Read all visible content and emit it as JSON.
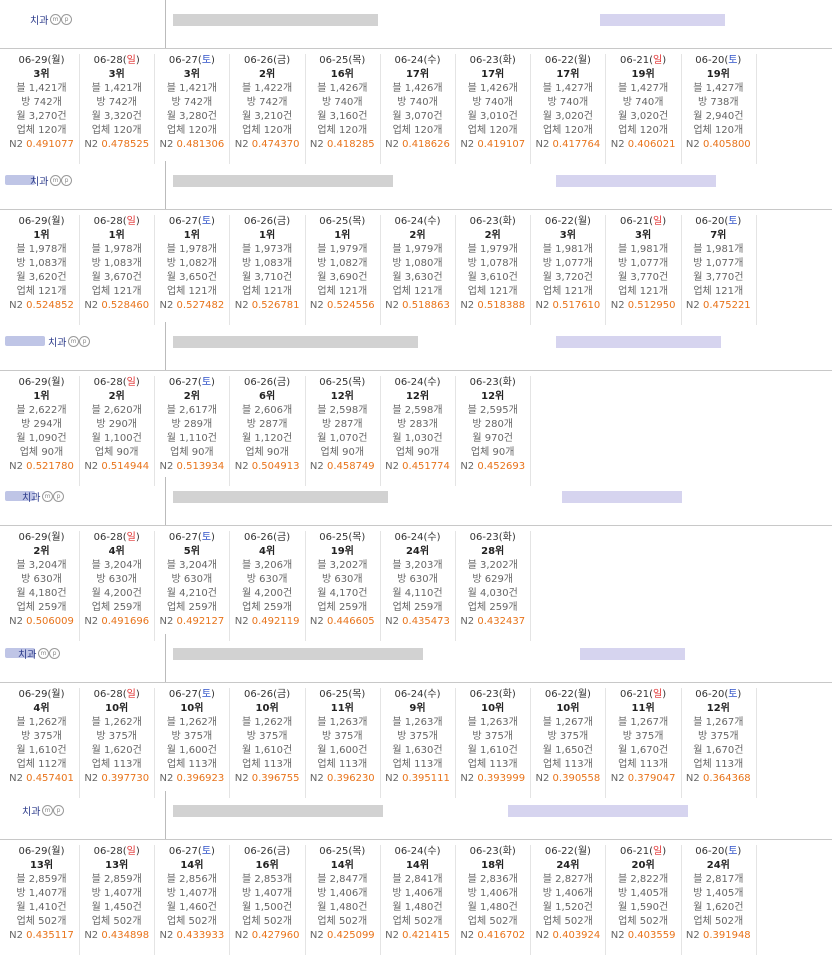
{
  "labels": {
    "n2_prefix": "N2",
    "map_icon_m": "m",
    "map_icon_p": "p"
  },
  "blocks": [
    {
      "name_suffix": "치과",
      "rows": [
        {
          "date": "06-29",
          "dow": "월",
          "rank": "3위",
          "blog": "블 1,421개",
          "bang": "방 742개",
          "month": "월 3,270건",
          "biz": "업체 120개",
          "n2": "0.491077"
        },
        {
          "date": "06-28",
          "dow": "일",
          "rank": "3위",
          "blog": "블 1,421개",
          "bang": "방 742개",
          "month": "월 3,320건",
          "biz": "업체 120개",
          "n2": "0.478525"
        },
        {
          "date": "06-27",
          "dow": "토",
          "rank": "3위",
          "blog": "블 1,421개",
          "bang": "방 742개",
          "month": "월 3,280건",
          "biz": "업체 120개",
          "n2": "0.481306"
        },
        {
          "date": "06-26",
          "dow": "금",
          "rank": "2위",
          "blog": "블 1,422개",
          "bang": "방 742개",
          "month": "월 3,210건",
          "biz": "업체 120개",
          "n2": "0.474370"
        },
        {
          "date": "06-25",
          "dow": "목",
          "rank": "16위",
          "blog": "블 1,426개",
          "bang": "방 740개",
          "month": "월 3,160건",
          "biz": "업체 120개",
          "n2": "0.418285"
        },
        {
          "date": "06-24",
          "dow": "수",
          "rank": "17위",
          "blog": "블 1,426개",
          "bang": "방 740개",
          "month": "월 3,070건",
          "biz": "업체 120개",
          "n2": "0.418626"
        },
        {
          "date": "06-23",
          "dow": "화",
          "rank": "17위",
          "blog": "블 1,426개",
          "bang": "방 740개",
          "month": "월 3,010건",
          "biz": "업체 120개",
          "n2": "0.419107"
        },
        {
          "date": "06-22",
          "dow": "월",
          "rank": "17위",
          "blog": "블 1,427개",
          "bang": "방 740개",
          "month": "월 3,020건",
          "biz": "업체 120개",
          "n2": "0.417764"
        },
        {
          "date": "06-21",
          "dow": "일",
          "rank": "19위",
          "blog": "블 1,427개",
          "bang": "방 740개",
          "month": "월 3,020건",
          "biz": "업체 120개",
          "n2": "0.406021"
        },
        {
          "date": "06-20",
          "dow": "토",
          "rank": "19위",
          "blog": "블 1,427개",
          "bang": "방 738개",
          "month": "월 2,940건",
          "biz": "업체 120개",
          "n2": "0.405800"
        }
      ]
    },
    {
      "name_suffix": "치과",
      "rows": [
        {
          "date": "06-29",
          "dow": "월",
          "rank": "1위",
          "blog": "블 1,978개",
          "bang": "방 1,083개",
          "month": "월 3,620건",
          "biz": "업체 121개",
          "n2": "0.524852"
        },
        {
          "date": "06-28",
          "dow": "일",
          "rank": "1위",
          "blog": "블 1,978개",
          "bang": "방 1,083개",
          "month": "월 3,670건",
          "biz": "업체 121개",
          "n2": "0.528460"
        },
        {
          "date": "06-27",
          "dow": "토",
          "rank": "1위",
          "blog": "블 1,978개",
          "bang": "방 1,082개",
          "month": "월 3,650건",
          "biz": "업체 121개",
          "n2": "0.527482"
        },
        {
          "date": "06-26",
          "dow": "금",
          "rank": "1위",
          "blog": "블 1,973개",
          "bang": "방 1,083개",
          "month": "월 3,710건",
          "biz": "업체 121개",
          "n2": "0.526781"
        },
        {
          "date": "06-25",
          "dow": "목",
          "rank": "1위",
          "blog": "블 1,979개",
          "bang": "방 1,082개",
          "month": "월 3,690건",
          "biz": "업체 121개",
          "n2": "0.524556"
        },
        {
          "date": "06-24",
          "dow": "수",
          "rank": "2위",
          "blog": "블 1,979개",
          "bang": "방 1,080개",
          "month": "월 3,630건",
          "biz": "업체 121개",
          "n2": "0.518863"
        },
        {
          "date": "06-23",
          "dow": "화",
          "rank": "2위",
          "blog": "블 1,979개",
          "bang": "방 1,078개",
          "month": "월 3,610건",
          "biz": "업체 121개",
          "n2": "0.518388"
        },
        {
          "date": "06-22",
          "dow": "월",
          "rank": "3위",
          "blog": "블 1,981개",
          "bang": "방 1,077개",
          "month": "월 3,720건",
          "biz": "업체 121개",
          "n2": "0.517610"
        },
        {
          "date": "06-21",
          "dow": "일",
          "rank": "3위",
          "blog": "블 1,981개",
          "bang": "방 1,077개",
          "month": "월 3,770건",
          "biz": "업체 121개",
          "n2": "0.512950"
        },
        {
          "date": "06-20",
          "dow": "토",
          "rank": "7위",
          "blog": "블 1,981개",
          "bang": "방 1,077개",
          "month": "월 3,770건",
          "biz": "업체 121개",
          "n2": "0.475221"
        }
      ]
    },
    {
      "name_suffix": "치과",
      "rows": [
        {
          "date": "06-29",
          "dow": "월",
          "rank": "1위",
          "blog": "블 2,622개",
          "bang": "방 294개",
          "month": "월 1,090건",
          "biz": "업체 90개",
          "n2": "0.521780"
        },
        {
          "date": "06-28",
          "dow": "일",
          "rank": "2위",
          "blog": "블 2,620개",
          "bang": "방 290개",
          "month": "월 1,100건",
          "biz": "업체 90개",
          "n2": "0.514944"
        },
        {
          "date": "06-27",
          "dow": "토",
          "rank": "2위",
          "blog": "블 2,617개",
          "bang": "방 289개",
          "month": "월 1,110건",
          "biz": "업체 90개",
          "n2": "0.513934"
        },
        {
          "date": "06-26",
          "dow": "금",
          "rank": "6위",
          "blog": "블 2,606개",
          "bang": "방 287개",
          "month": "월 1,120건",
          "biz": "업체 90개",
          "n2": "0.504913"
        },
        {
          "date": "06-25",
          "dow": "목",
          "rank": "12위",
          "blog": "블 2,598개",
          "bang": "방 287개",
          "month": "월 1,070건",
          "biz": "업체 90개",
          "n2": "0.458749"
        },
        {
          "date": "06-24",
          "dow": "수",
          "rank": "12위",
          "blog": "블 2,598개",
          "bang": "방 283개",
          "month": "월 1,030건",
          "biz": "업체 90개",
          "n2": "0.451774"
        },
        {
          "date": "06-23",
          "dow": "화",
          "rank": "12위",
          "blog": "블 2,595개",
          "bang": "방 280개",
          "month": "월 970건",
          "biz": "업체 90개",
          "n2": "0.452693"
        }
      ]
    },
    {
      "name_suffix": "치과",
      "rows": [
        {
          "date": "06-29",
          "dow": "월",
          "rank": "2위",
          "blog": "블 3,204개",
          "bang": "방 630개",
          "month": "월 4,180건",
          "biz": "업체 259개",
          "n2": "0.506009"
        },
        {
          "date": "06-28",
          "dow": "일",
          "rank": "4위",
          "blog": "블 3,204개",
          "bang": "방 630개",
          "month": "월 4,200건",
          "biz": "업체 259개",
          "n2": "0.491696"
        },
        {
          "date": "06-27",
          "dow": "토",
          "rank": "5위",
          "blog": "블 3,204개",
          "bang": "방 630개",
          "month": "월 4,210건",
          "biz": "업체 259개",
          "n2": "0.492127"
        },
        {
          "date": "06-26",
          "dow": "금",
          "rank": "4위",
          "blog": "블 3,206개",
          "bang": "방 630개",
          "month": "월 4,200건",
          "biz": "업체 259개",
          "n2": "0.492119"
        },
        {
          "date": "06-25",
          "dow": "목",
          "rank": "19위",
          "blog": "블 3,202개",
          "bang": "방 630개",
          "month": "월 4,170건",
          "biz": "업체 259개",
          "n2": "0.446605"
        },
        {
          "date": "06-24",
          "dow": "수",
          "rank": "24위",
          "blog": "블 3,203개",
          "bang": "방 630개",
          "month": "월 4,110건",
          "biz": "업체 259개",
          "n2": "0.435473"
        },
        {
          "date": "06-23",
          "dow": "화",
          "rank": "28위",
          "blog": "블 3,202개",
          "bang": "방 629개",
          "month": "월 4,030건",
          "biz": "업체 259개",
          "n2": "0.432437"
        }
      ]
    },
    {
      "name_suffix": "치과",
      "rows": [
        {
          "date": "06-29",
          "dow": "월",
          "rank": "4위",
          "blog": "블 1,262개",
          "bang": "방 375개",
          "month": "월 1,610건",
          "biz": "업체 112개",
          "n2": "0.457401"
        },
        {
          "date": "06-28",
          "dow": "일",
          "rank": "10위",
          "blog": "블 1,262개",
          "bang": "방 375개",
          "month": "월 1,620건",
          "biz": "업체 113개",
          "n2": "0.397730"
        },
        {
          "date": "06-27",
          "dow": "토",
          "rank": "10위",
          "blog": "블 1,262개",
          "bang": "방 375개",
          "month": "월 1,600건",
          "biz": "업체 113개",
          "n2": "0.396923"
        },
        {
          "date": "06-26",
          "dow": "금",
          "rank": "10위",
          "blog": "블 1,262개",
          "bang": "방 375개",
          "month": "월 1,610건",
          "biz": "업체 113개",
          "n2": "0.396755"
        },
        {
          "date": "06-25",
          "dow": "목",
          "rank": "11위",
          "blog": "블 1,263개",
          "bang": "방 375개",
          "month": "월 1,600건",
          "biz": "업체 113개",
          "n2": "0.396230"
        },
        {
          "date": "06-24",
          "dow": "수",
          "rank": "9위",
          "blog": "블 1,263개",
          "bang": "방 375개",
          "month": "월 1,630건",
          "biz": "업체 113개",
          "n2": "0.395111"
        },
        {
          "date": "06-23",
          "dow": "화",
          "rank": "10위",
          "blog": "블 1,263개",
          "bang": "방 375개",
          "month": "월 1,610건",
          "biz": "업체 113개",
          "n2": "0.393999"
        },
        {
          "date": "06-22",
          "dow": "월",
          "rank": "10위",
          "blog": "블 1,267개",
          "bang": "방 375개",
          "month": "월 1,650건",
          "biz": "업체 113개",
          "n2": "0.390558"
        },
        {
          "date": "06-21",
          "dow": "일",
          "rank": "11위",
          "blog": "블 1,267개",
          "bang": "방 375개",
          "month": "월 1,670건",
          "biz": "업체 113개",
          "n2": "0.379047"
        },
        {
          "date": "06-20",
          "dow": "토",
          "rank": "12위",
          "blog": "블 1,267개",
          "bang": "방 375개",
          "month": "월 1,670건",
          "biz": "업체 113개",
          "n2": "0.364368"
        }
      ]
    },
    {
      "name_suffix": "치과",
      "rows": [
        {
          "date": "06-29",
          "dow": "월",
          "rank": "13위",
          "blog": "블 2,859개",
          "bang": "방 1,407개",
          "month": "월 1,410건",
          "biz": "업체 502개",
          "n2": "0.435117"
        },
        {
          "date": "06-28",
          "dow": "일",
          "rank": "13위",
          "blog": "블 2,859개",
          "bang": "방 1,407개",
          "month": "월 1,450건",
          "biz": "업체 502개",
          "n2": "0.434898"
        },
        {
          "date": "06-27",
          "dow": "토",
          "rank": "14위",
          "blog": "블 2,856개",
          "bang": "방 1,407개",
          "month": "월 1,460건",
          "biz": "업체 502개",
          "n2": "0.433933"
        },
        {
          "date": "06-26",
          "dow": "금",
          "rank": "16위",
          "blog": "블 2,853개",
          "bang": "방 1,407개",
          "month": "월 1,500건",
          "biz": "업체 502개",
          "n2": "0.427960"
        },
        {
          "date": "06-25",
          "dow": "목",
          "rank": "14위",
          "blog": "블 2,847개",
          "bang": "방 1,406개",
          "month": "월 1,480건",
          "biz": "업체 502개",
          "n2": "0.425099"
        },
        {
          "date": "06-24",
          "dow": "수",
          "rank": "14위",
          "blog": "블 2,841개",
          "bang": "방 1,406개",
          "month": "월 1,480건",
          "biz": "업체 502개",
          "n2": "0.421415"
        },
        {
          "date": "06-23",
          "dow": "화",
          "rank": "18위",
          "blog": "블 2,836개",
          "bang": "방 1,406개",
          "month": "월 1,480건",
          "biz": "업체 502개",
          "n2": "0.416702"
        },
        {
          "date": "06-22",
          "dow": "월",
          "rank": "24위",
          "blog": "블 2,827개",
          "bang": "방 1,406개",
          "month": "월 1,520건",
          "biz": "업체 502개",
          "n2": "0.403924"
        },
        {
          "date": "06-21",
          "dow": "일",
          "rank": "20위",
          "blog": "블 2,822개",
          "bang": "방 1,405개",
          "month": "월 1,590건",
          "biz": "업체 502개",
          "n2": "0.403559"
        },
        {
          "date": "06-20",
          "dow": "토",
          "rank": "24위",
          "blog": "블 2,817개",
          "bang": "방 1,405개",
          "month": "월 1,620건",
          "biz": "업체 502개",
          "n2": "0.391948"
        }
      ]
    }
  ]
}
